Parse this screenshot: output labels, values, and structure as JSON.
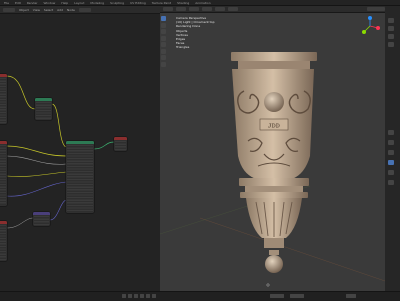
{
  "app": {
    "menu": [
      "File",
      "Edit",
      "Render",
      "Window",
      "Help",
      "Layout",
      "Modeling",
      "Sculpting",
      "UV Editing",
      "Texture Paint",
      "Shading",
      "Animation"
    ]
  },
  "node_editor": {
    "header_items": [
      "Object",
      "View",
      "Select",
      "Add",
      "Node"
    ]
  },
  "viewport": {
    "stats": [
      "Camera Perspective",
      "(10) Light | Ornament top",
      "Rendering Done",
      "Objects",
      "Vertices",
      "Edges",
      "Faces",
      "Triangles"
    ]
  },
  "colors": {
    "accent": "#4772b3",
    "socket_yellow": "#c7c729",
    "socket_purple": "#6363c7",
    "socket_grey": "#a1a1a1",
    "node_header_green": "#2d7a54",
    "node_header_red": "#8a2e2e",
    "node_header_purple": "#4a3f7a",
    "node_header_grey": "#4a4a4a",
    "ornament_stone": "#c9b39a"
  },
  "icons": [
    "gear-icon",
    "camera-icon",
    "render-icon",
    "material-icon",
    "sphere-icon",
    "wrench-icon",
    "constraint-icon",
    "data-icon"
  ]
}
